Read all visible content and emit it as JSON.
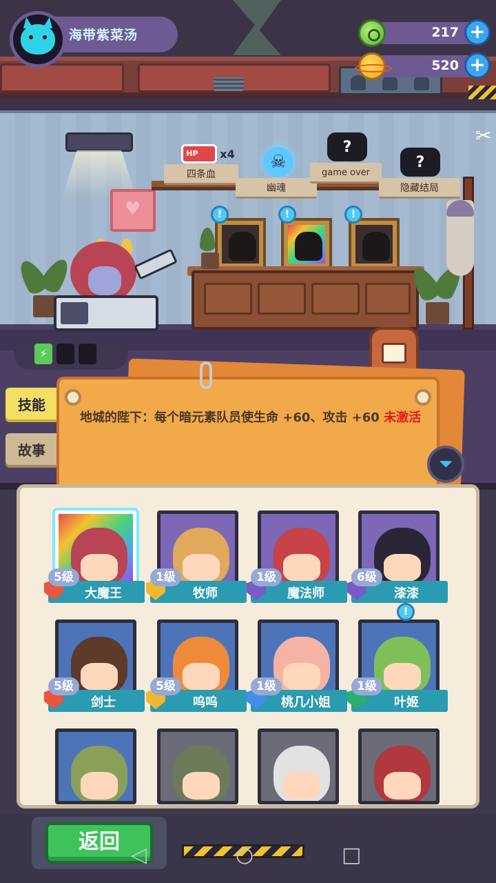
{
  "player": {
    "name": "海带紫菜汤"
  },
  "currency": [
    {
      "value": "217",
      "icon": "green-gem-icon"
    },
    {
      "value": "520",
      "icon": "gold-planet-icon"
    }
  ],
  "achievements": [
    {
      "label": "四条血",
      "icon": "hp-battery-x4-icon",
      "badge": "x4",
      "hp_text": "HP"
    },
    {
      "label": "幽魂",
      "icon": "ghost-skull-icon"
    },
    {
      "label": "game over",
      "icon": "mystery-tv-icon",
      "glyph": "?"
    },
    {
      "label": "隐藏结局",
      "icon": "mystery-tv-icon",
      "glyph": "?"
    }
  ],
  "alerts": {
    "glyph": "!"
  },
  "tabs": {
    "skill": "技能",
    "story": "故事"
  },
  "skill": {
    "description": "地城的陛下：每个暗元素队员使生命 +60、攻击 +60",
    "status": "未激活"
  },
  "roster": [
    {
      "name": "大魔王",
      "level": "5级",
      "badge": "red",
      "hair": "#b84455",
      "bg": "rainbow",
      "selected": true
    },
    {
      "name": "牧师",
      "level": "1级",
      "badge": "gold",
      "hair": "#e0a95c",
      "bg": "#7d67b7"
    },
    {
      "name": "魔法师",
      "level": "1级",
      "badge": "purple",
      "hair": "#c8424a",
      "bg": "#7d67b7"
    },
    {
      "name": "漆漆",
      "level": "6级",
      "badge": "purple",
      "hair": "#2b2637",
      "bg": "#7d67b7"
    },
    {
      "name": "剑士",
      "level": "5级",
      "badge": "red",
      "hair": "#5d3a2a",
      "bg": "#4d74b8"
    },
    {
      "name": "呜呜",
      "level": "5级",
      "badge": "gold",
      "hair": "#ef8a3a",
      "bg": "#4d74b8"
    },
    {
      "name": "桃几小姐",
      "level": "1级",
      "badge": "blue",
      "hair": "#f5b3a5",
      "bg": "#4d74b8"
    },
    {
      "name": "叶姬",
      "level": "1级",
      "badge": "green",
      "hair": "#7fbf5a",
      "bg": "#4d74b8",
      "alert": true
    },
    {
      "name": "",
      "level": "",
      "badge": "gold",
      "hair": "#8aa05a",
      "bg": "#4d74b8"
    },
    {
      "name": "",
      "level": "",
      "badge": "gold",
      "hair": "#6c7a5a",
      "bg": "#6c6c78"
    },
    {
      "name": "",
      "level": "",
      "badge": "gold",
      "hair": "#e2e2e2",
      "bg": "#6c6c78"
    },
    {
      "name": "",
      "level": "",
      "badge": "gold",
      "hair": "#b0383e",
      "bg": "#6c6c78"
    }
  ],
  "buttons": {
    "back": "返回",
    "plus": "+"
  },
  "android_nav": {
    "back": "◁",
    "home": "○",
    "recents": "□"
  }
}
